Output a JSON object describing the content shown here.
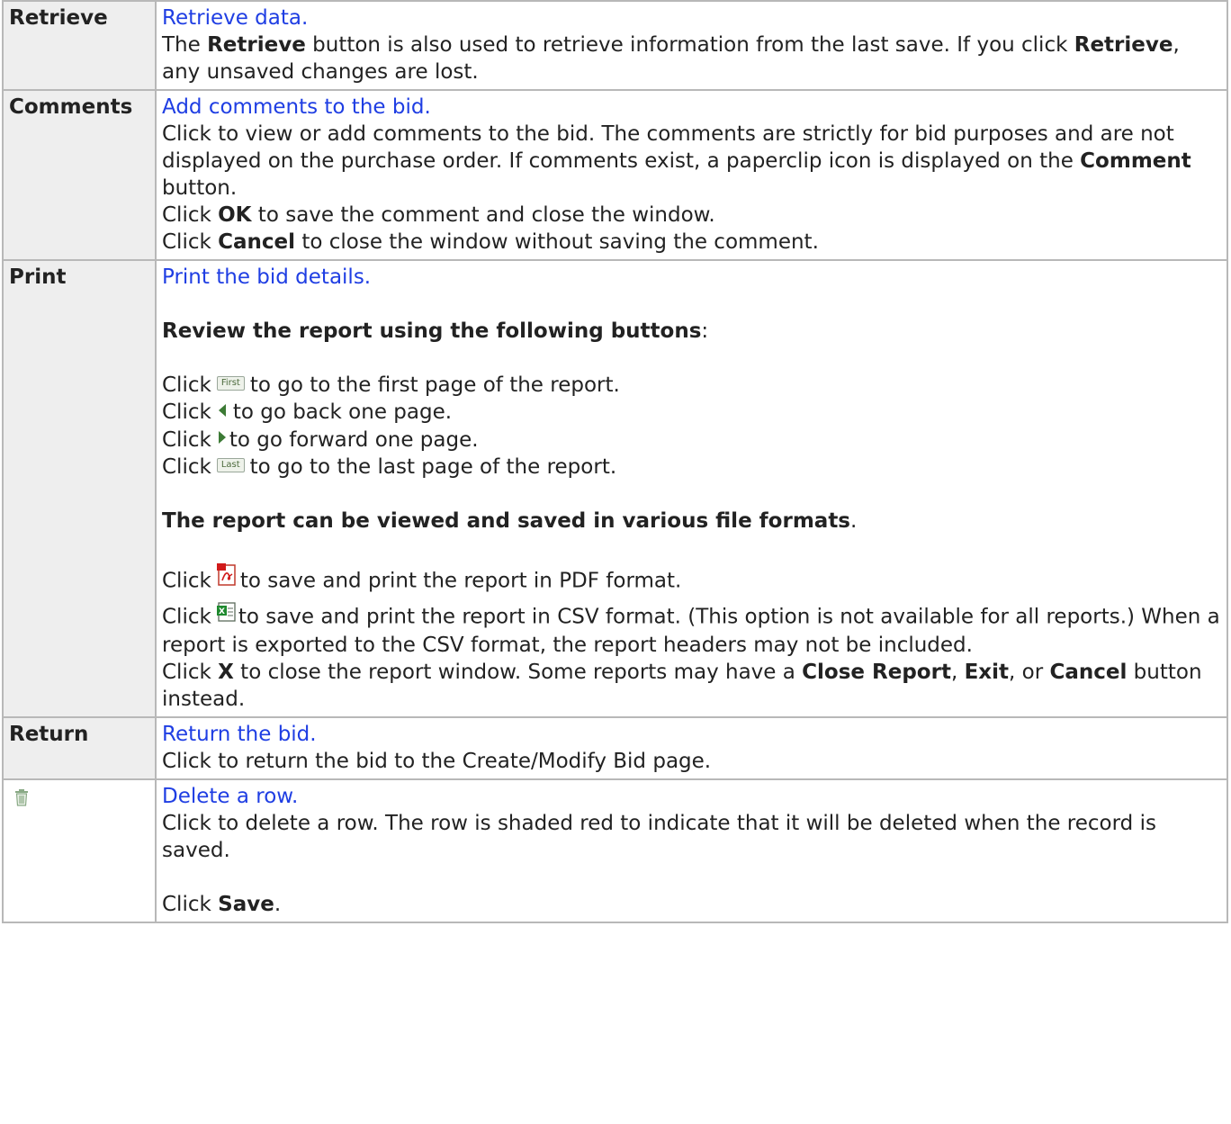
{
  "rows": {
    "retrieve": {
      "key": "Retrieve",
      "link": "Retrieve data.",
      "p1_pre": "The ",
      "p1_b1": "Retrieve",
      "p1_mid": " button is also used to retrieve information from the last save. If you click ",
      "p1_b2": "Retrieve",
      "p1_post": ", any unsaved changes are lost."
    },
    "comments": {
      "key": "Comments",
      "link": "Add comments to the bid.",
      "p1_pre": "Click to view or add comments to the bid. The comments are strictly for bid purposes and are not displayed on the purchase order. If comments exist, a paperclip icon is displayed on the ",
      "p1_b": "Comment",
      "p1_post": " button.",
      "p2_pre": "Click ",
      "p2_b": "OK",
      "p2_post": " to save the comment and close the window.",
      "p3_pre": "Click ",
      "p3_b": "Cancel",
      "p3_post": " to close the window without saving the comment."
    },
    "print": {
      "key": "Print",
      "link": "Print the bid details.",
      "review_heading": "Review the report using the following buttons",
      "review_colon": ":",
      "click": "Click",
      "first_btn": "First",
      "last_btn": "Last",
      "nav_first": "to go to the first page of the report.",
      "nav_back": "to go back one page.",
      "nav_forward": "to go forward one page.",
      "nav_last": "to go to the last page of the report.",
      "formats_heading": "The report can be viewed and saved in various file formats",
      "formats_period": ".",
      "pdf_text": "to save and print the report in PDF format.",
      "csv_text": "to save and print the report in CSV format. (This option is not available for all reports.) When a report is exported to the CSV format, the report headers may not be included.",
      "close_pre": "Click ",
      "close_b1": "X",
      "close_mid": " to close the report window. Some reports may have a ",
      "close_b2": "Close Report",
      "close_sep1": ", ",
      "close_b3": "Exit",
      "close_sep2": ", or ",
      "close_b4": "Cancel",
      "close_post": " button instead."
    },
    "return": {
      "key": "Return",
      "link": "Return the bid.",
      "text": "Click to return the bid to the Create/Modify Bid page."
    },
    "delete": {
      "icon": "trash-icon",
      "link": "Delete a row.",
      "text": "Click to delete a row. The row is shaded red to indicate that it will be deleted when the record is saved.",
      "save_pre": "Click ",
      "save_b": "Save",
      "save_post": "."
    }
  },
  "colors": {
    "link": "#1f3ee3",
    "border": "#b8b8b8",
    "header_bg": "#eeeeee",
    "text": "#222222"
  }
}
